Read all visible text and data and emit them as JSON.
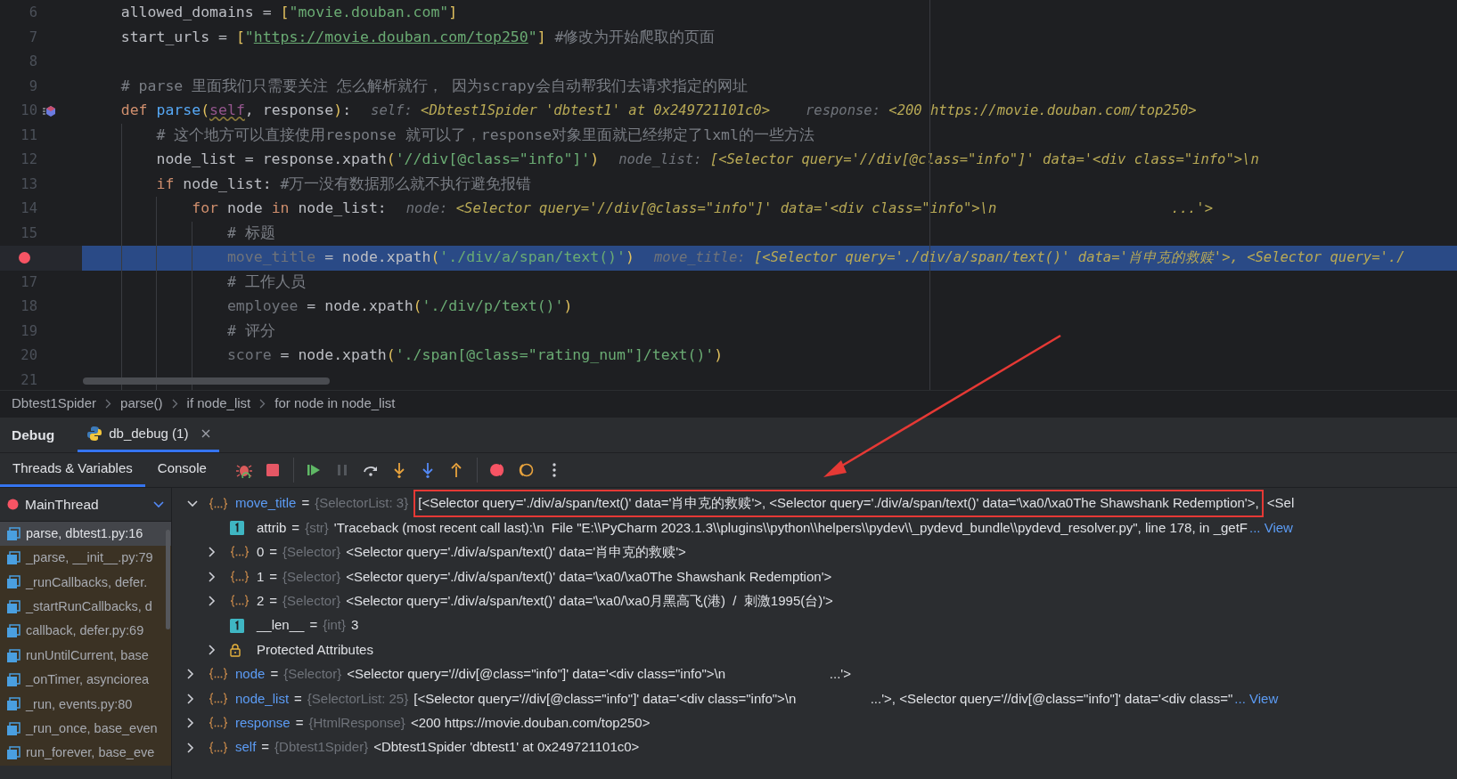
{
  "editor": {
    "lines": [
      {
        "number": "6",
        "current": false,
        "breakpoint": false,
        "gutter_icon": false,
        "tokens": [
          {
            "kind": "plain",
            "text": "allowed_domains = "
          },
          {
            "kind": "bracket",
            "text": "["
          },
          {
            "kind": "string",
            "text": "\"movie.douban.com\""
          },
          {
            "kind": "bracket",
            "text": "]"
          }
        ]
      },
      {
        "number": "7",
        "current": false,
        "breakpoint": false,
        "gutter_icon": false,
        "tokens": [
          {
            "kind": "plain",
            "text": "start_urls = "
          },
          {
            "kind": "bracket",
            "text": "["
          },
          {
            "kind": "string",
            "text": "\""
          },
          {
            "kind": "url",
            "text": "https://movie.douban.com/top250"
          },
          {
            "kind": "string",
            "text": "\""
          },
          {
            "kind": "bracket",
            "text": "]"
          },
          {
            "kind": "comment",
            "text": " #修改为开始爬取的页面"
          }
        ]
      },
      {
        "number": "8",
        "current": false,
        "breakpoint": false,
        "gutter_icon": false
      },
      {
        "number": "9",
        "current": false,
        "breakpoint": false,
        "gutter_icon": false,
        "tokens": [
          {
            "kind": "comment",
            "text": "# parse 里面我们只需要关注 怎么解析就行， 因为scrapy会自动帮我们去请求指定的网址"
          }
        ]
      },
      {
        "number": "10",
        "current": false,
        "breakpoint": false,
        "gutter_icon": true,
        "tokens": [
          {
            "kind": "keyword",
            "text": "def "
          },
          {
            "kind": "func",
            "text": "parse"
          },
          {
            "kind": "bracket",
            "text": "("
          },
          {
            "kind": "self",
            "text": "self"
          },
          {
            "kind": "plain",
            "text": ", response"
          },
          {
            "kind": "bracket",
            "text": ")"
          },
          {
            "kind": "plain",
            "text": ":"
          }
        ],
        "hints": [
          {
            "label": "self:",
            "value": "<Dbtest1Spider 'dbtest1' at 0x249721101c0>"
          },
          {
            "label": "response:",
            "value": "<200 https://movie.douban.com/top250>"
          }
        ],
        "children": [
          {
            "number": "11",
            "current": false,
            "breakpoint": false,
            "gutter_icon": false,
            "tokens": [
              {
                "kind": "comment",
                "text": "# 这个地方可以直接使用response 就可以了，response对象里面就已经绑定了lxml的一些方法"
              }
            ]
          },
          {
            "number": "12",
            "current": false,
            "breakpoint": false,
            "gutter_icon": false,
            "tokens": [
              {
                "kind": "plain",
                "text": "node_list = response.xpath"
              },
              {
                "kind": "bracket",
                "text": "("
              },
              {
                "kind": "string",
                "text": "'//div[@class=\"info\"]'"
              },
              {
                "kind": "bracket",
                "text": ")"
              }
            ],
            "hints": [
              {
                "label": "node_list:",
                "value": "[<Selector query='//div[@class=\"info\"]' data='<div class=\"info\">\\n"
              }
            ]
          },
          {
            "number": "13",
            "current": false,
            "breakpoint": false,
            "gutter_icon": false,
            "tokens": [
              {
                "kind": "keyword",
                "text": "if "
              },
              {
                "kind": "plain",
                "text": "node_list:"
              },
              {
                "kind": "comment",
                "text": " #万一没有数据那么就不执行避免报错"
              }
            ],
            "children": [
              {
                "number": "14",
                "current": false,
                "breakpoint": false,
                "gutter_icon": false,
                "tokens": [
                  {
                    "kind": "keyword",
                    "text": "for "
                  },
                  {
                    "kind": "plain",
                    "text": "node "
                  },
                  {
                    "kind": "keyword",
                    "text": "in "
                  },
                  {
                    "kind": "plain",
                    "text": "node_list:"
                  }
                ],
                "hints": [
                  {
                    "label": "node:",
                    "value": "<Selector query='//div[@class=\"info\"]' data='<div class=\"info\">\\n                     ...'>"
                  }
                ],
                "children": [
                  {
                    "number": "15",
                    "current": false,
                    "breakpoint": false,
                    "gutter_icon": false,
                    "tokens": [
                      {
                        "kind": "comment",
                        "text": "# 标题"
                      }
                    ]
                  },
                  {
                    "current": true,
                    "breakpoint": true,
                    "gutter_icon": false,
                    "tokens": [
                      {
                        "kind": "dim",
                        "text": "move_title"
                      },
                      {
                        "kind": "plain",
                        "text": " = node.xpath"
                      },
                      {
                        "kind": "bracket",
                        "text": "("
                      },
                      {
                        "kind": "string",
                        "text": "'./div/a/span/text()'"
                      },
                      {
                        "kind": "bracket",
                        "text": ")"
                      }
                    ],
                    "hints": [
                      {
                        "label": "move_title:",
                        "value": "[<Selector query='./div/a/span/text()' data='肖申克的救赎'>, <Selector query='./"
                      }
                    ]
                  },
                  {
                    "number": "17",
                    "current": false,
                    "breakpoint": false,
                    "gutter_icon": false,
                    "tokens": [
                      {
                        "kind": "comment",
                        "text": "# 工作人员"
                      }
                    ]
                  },
                  {
                    "number": "18",
                    "current": false,
                    "breakpoint": false,
                    "gutter_icon": false,
                    "tokens": [
                      {
                        "kind": "dim",
                        "text": "employee"
                      },
                      {
                        "kind": "plain",
                        "text": " = node.xpath"
                      },
                      {
                        "kind": "bracket",
                        "text": "("
                      },
                      {
                        "kind": "string",
                        "text": "'./div/p/text()'"
                      },
                      {
                        "kind": "bracket",
                        "text": ")"
                      }
                    ]
                  },
                  {
                    "number": "19",
                    "current": false,
                    "breakpoint": false,
                    "gutter_icon": false,
                    "tokens": [
                      {
                        "kind": "comment",
                        "text": "# 评分"
                      }
                    ]
                  },
                  {
                    "number": "20",
                    "current": false,
                    "breakpoint": false,
                    "gutter_icon": false,
                    "tokens": [
                      {
                        "kind": "dim",
                        "text": "score"
                      },
                      {
                        "kind": "plain",
                        "text": " = node.xpath"
                      },
                      {
                        "kind": "bracket",
                        "text": "("
                      },
                      {
                        "kind": "string",
                        "text": "'./span[@class=\"rating_num\"]/text()'"
                      },
                      {
                        "kind": "bracket",
                        "text": ")"
                      }
                    ]
                  },
                  {
                    "number": "21",
                    "current": false,
                    "breakpoint": false,
                    "gutter_icon": false
                  }
                ]
              }
            ]
          }
        ]
      }
    ]
  },
  "breadcrumb": [
    "Dbtest1Spider",
    "parse()",
    "if node_list",
    "for node in node_list"
  ],
  "debug": {
    "title": "Debug",
    "tabs": [
      {
        "label": "db_debug (1)",
        "selected": true
      }
    ],
    "subtabs": [
      {
        "label": "Threads & Variables",
        "selected": true
      },
      {
        "label": "Console",
        "selected": false
      }
    ],
    "toolbar": [
      {
        "kind": "rerun",
        "separator_before": false,
        "disabled": false
      },
      {
        "kind": "stop",
        "separator_before": false,
        "disabled": false
      },
      {
        "kind": "resume",
        "separator_before": true,
        "disabled": false
      },
      {
        "kind": "pause",
        "separator_before": false,
        "disabled": true
      },
      {
        "kind": "step_over",
        "separator_before": false,
        "disabled": false
      },
      {
        "kind": "step_into",
        "separator_before": false,
        "disabled": false
      },
      {
        "kind": "step_into_my_code",
        "separator_before": false,
        "disabled": false
      },
      {
        "kind": "step_out",
        "separator_before": false,
        "disabled": false
      },
      {
        "kind": "breakpoints",
        "separator_before": true,
        "disabled": false
      },
      {
        "kind": "mute_breakpoints",
        "separator_before": false,
        "disabled": false
      },
      {
        "kind": "more",
        "separator_before": false,
        "disabled": false
      }
    ],
    "thread": {
      "name": "MainThread"
    },
    "frames": [
      {
        "label": "parse, dbtest1.py:16",
        "selected": true,
        "library": false
      },
      {
        "label": "_parse, __init__.py:79",
        "selected": false,
        "library": true
      },
      {
        "label": "_runCallbacks, defer.",
        "selected": false,
        "library": true
      },
      {
        "label": "_startRunCallbacks, d",
        "selected": false,
        "library": true
      },
      {
        "label": "callback, defer.py:69",
        "selected": false,
        "library": true
      },
      {
        "label": "runUntilCurrent, base",
        "selected": false,
        "library": true
      },
      {
        "label": "_onTimer, asynciorea",
        "selected": false,
        "library": true
      },
      {
        "label": "_run, events.py:80",
        "selected": false,
        "library": true
      },
      {
        "label": "_run_once, base_even",
        "selected": false,
        "library": true
      },
      {
        "label": "run_forever, base_eve",
        "selected": false,
        "library": true
      }
    ],
    "variables": [
      {
        "kind": "object",
        "name": "move_title",
        "op": "=",
        "type": "{SelectorList: 3}",
        "expanded": true,
        "value_parts": [
          {
            "text": "[<Selector query='./div/a/span/text()' data='肖申克的救赎'>, <Selector query='./div/a/span/text()' data='\\xa0/\\xa0The Shawshank Redemption'>,",
            "highlighted": true
          },
          {
            "text": " <Sel",
            "highlighted": false
          }
        ],
        "children": [
          {
            "kind": "primitive",
            "name": "attrib",
            "op": "=",
            "type": "{str}",
            "value_parts": [
              {
                "text": "'Traceback (most recent call last):\\n  File \"E:\\\\PyCharm 2023.1.3\\\\plugins\\\\python\\\\helpers\\\\pydev\\\\_pydevd_bundle\\\\pydevd_resolver.py\", line 178, in _getF",
                "highlighted": false
              }
            ],
            "view_link": "... View"
          },
          {
            "kind": "object",
            "name": "0",
            "op": "=",
            "type": "{Selector}",
            "expanded": false,
            "value_parts": [
              {
                "text": "<Selector query='./div/a/span/text()' data='肖申克的救赎'>",
                "highlighted": false
              }
            ]
          },
          {
            "kind": "object",
            "name": "1",
            "op": "=",
            "type": "{Selector}",
            "expanded": false,
            "value_parts": [
              {
                "text": "<Selector query='./div/a/span/text()' data='\\xa0/\\xa0The Shawshank Redemption'>",
                "highlighted": false
              }
            ]
          },
          {
            "kind": "object",
            "name": "2",
            "op": "=",
            "type": "{Selector}",
            "expanded": false,
            "value_parts": [
              {
                "text": "<Selector query='./div/a/span/text()' data='\\xa0/\\xa0月黑高飞(港)  /  刺激1995(台)'>",
                "highlighted": false
              }
            ]
          },
          {
            "kind": "primitive",
            "name": "__len__",
            "op": "=",
            "type": "{int}",
            "value_parts": [
              {
                "text": "3",
                "highlighted": false
              }
            ]
          },
          {
            "kind": "group",
            "name": "Protected Attributes",
            "expanded": false
          }
        ]
      },
      {
        "kind": "object",
        "name": "node",
        "op": "=",
        "type": "{Selector}",
        "expanded": false,
        "value_parts": [
          {
            "text": "<Selector query='//div[@class=\"info\"]' data='<div class=\"info\">\\n                            ...'>",
            "highlighted": false
          }
        ]
      },
      {
        "kind": "object",
        "name": "node_list",
        "op": "=",
        "type": "{SelectorList: 25}",
        "expanded": false,
        "value_parts": [
          {
            "text": "[<Selector query='//div[@class=\"info\"]' data='<div class=\"info\">\\n                    ...'>, <Selector query='//div[@class=\"info\"]' data='<div class=\"",
            "highlighted": false
          }
        ],
        "view_link": "... View"
      },
      {
        "kind": "object",
        "name": "response",
        "op": "=",
        "type": "{HtmlResponse}",
        "expanded": false,
        "value_parts": [
          {
            "text": "<200 https://movie.douban.com/top250>",
            "highlighted": false
          }
        ]
      },
      {
        "kind": "object",
        "name": "self",
        "op": "=",
        "type": "{Dbtest1Spider}",
        "expanded": false,
        "value_parts": [
          {
            "text": "<Dbtest1Spider 'dbtest1' at 0x249721101c0>",
            "highlighted": false
          }
        ]
      }
    ]
  }
}
